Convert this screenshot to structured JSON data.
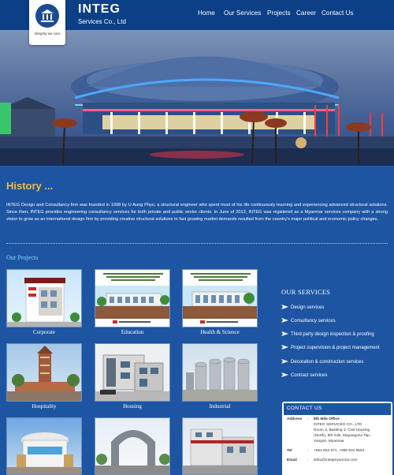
{
  "brand": {
    "name": "INTEG",
    "subtitle": "Services Co., Ltd",
    "tagline": "Integrity we care"
  },
  "nav": {
    "items": [
      {
        "label": "Home"
      },
      {
        "label": "Our Services"
      },
      {
        "label": "Projects"
      },
      {
        "label": "Career"
      },
      {
        "label": "Contact Us"
      }
    ]
  },
  "history": {
    "title": "History ...",
    "text": "INTEG Design and Consultancy firm was founded in 1998 by U Aung Phyo, a structural engineer who spent most of his life continuously learning and experiencing advanced structural solutions. Since then, INTEG provides engineering consultancy services for both private and public sector clients. In June of 2013, INTEG was registered as a Myanmar services company with a strong vision to grow as an international design firm by providing creative structural solutions to fast growing market demands resulted from the country's major political and economic policy changes."
  },
  "projects": {
    "title": "Our Projects",
    "tiles": [
      {
        "caption": "Corporate"
      },
      {
        "caption": "Education"
      },
      {
        "caption": "Health & Science"
      },
      {
        "caption": "Hospitality"
      },
      {
        "caption": "Housing"
      },
      {
        "caption": "Industrial"
      },
      {
        "caption": ""
      },
      {
        "caption": ""
      },
      {
        "caption": ""
      }
    ]
  },
  "services": {
    "title": "OUR SERVICES",
    "items": [
      {
        "label": "Design services"
      },
      {
        "label": "Consultancy services"
      },
      {
        "label": "Third party design inspection & proofing"
      },
      {
        "label": "Project supervision & project management"
      },
      {
        "label": "Decoration & construction services"
      },
      {
        "label": "Contract services"
      }
    ]
  },
  "contact": {
    "title": "CONTACT US",
    "address_label": "Address",
    "address_line1": "8th Mile Office",
    "address_line2": "INTEG SERVICES CO., LTD",
    "address_line3": "Room 3, Building 3, Civil Housing",
    "address_line4": "(North), 8th mile, Mayangone Tsp,",
    "address_line5": "Yangon, Myanmar",
    "tel_label": "Tel",
    "tel": "+951 662 571, +959 501 5564",
    "email_label": "Email",
    "email": "sithu@integmyanmar.com",
    "separator": ":"
  },
  "colors": {
    "background": "#1d55a3",
    "header": "#0b3f86",
    "history_title": "#f2b944",
    "projects_title": "#87d8ff"
  }
}
